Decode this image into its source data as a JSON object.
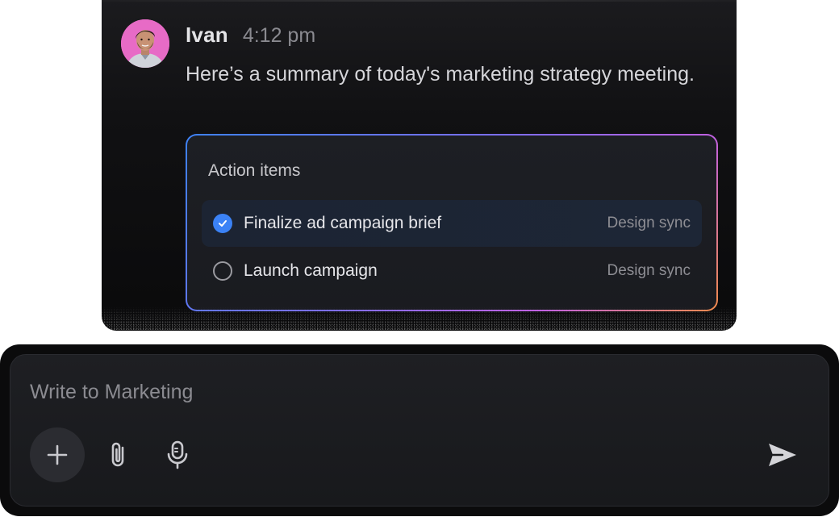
{
  "message": {
    "sender_name": "Ivan",
    "time": "4:12 pm",
    "text": "Here’s a summary of today's marketing strategy meeting.",
    "avatar_color": "#e76bc6"
  },
  "action_items": {
    "title": "Action items",
    "items": [
      {
        "label": "Finalize ad campaign brief",
        "tag": "Design sync",
        "done": true
      },
      {
        "label": "Launch campaign",
        "tag": "Design sync",
        "done": false
      }
    ],
    "gradient": [
      "#3d82f5",
      "#7b6df0",
      "#c060e0",
      "#f08a4a"
    ]
  },
  "composer": {
    "placeholder": "Write to Marketing",
    "value": "",
    "icons": [
      "plus-icon",
      "paperclip-icon",
      "microphone-icon",
      "send-icon"
    ]
  },
  "colors": {
    "accent": "#3b82f6",
    "background": "#111113"
  }
}
